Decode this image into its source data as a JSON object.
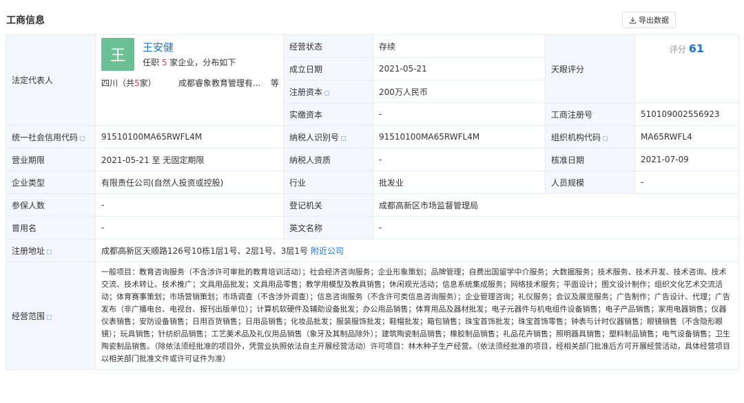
{
  "header": {
    "title": "工商信息",
    "export_label": "导出数据"
  },
  "legal_rep": {
    "label": "法定代表人",
    "avatar_char": "王",
    "name": "王安健",
    "desc_prefix": "任职 ",
    "desc_count": "5",
    "desc_suffix": " 家企业，分布如下",
    "region_prefix": "四川（共",
    "region_count": "5",
    "region_suffix": "家）",
    "company": "成都睿象教育管理有...",
    "more": "等"
  },
  "rows": {
    "status_label": "经营状态",
    "status_value": "存续",
    "founded_label": "成立日期",
    "founded_value": "2021-05-21",
    "reg_capital_label": "注册资本",
    "reg_capital_value": "200万人民币",
    "paid_capital_label": "实缴资本",
    "paid_capital_value": "-",
    "score_label": "天眼评分",
    "score_small_label": "评分",
    "score_value": "61",
    "biz_reg_no_label": "工商注册号",
    "biz_reg_no_value": "510109002556923",
    "credit_code_label": "统一社会信用代码",
    "credit_code_value": "91510100MA65RWFL4M",
    "taxpayer_id_label": "纳税人识别号",
    "taxpayer_id_value": "91510100MA65RWFL4M",
    "org_code_label": "组织机构代码",
    "org_code_value": "MA65RWFL4",
    "term_label": "营业期限",
    "term_value": "2021-05-21 至 无固定期限",
    "taxpayer_qual_label": "纳税人资质",
    "taxpayer_qual_value": "-",
    "approve_date_label": "核准日期",
    "approve_date_value": "2021-07-09",
    "company_type_label": "企业类型",
    "company_type_value": "有限责任公司(自然人投资或控股)",
    "industry_label": "行业",
    "industry_value": "批发业",
    "staff_size_label": "人员规模",
    "staff_size_value": "-",
    "insured_label": "参保人数",
    "insured_value": "-",
    "reg_authority_label": "登记机关",
    "reg_authority_value": "成都高新区市场监督管理局",
    "former_name_label": "曾用名",
    "former_name_value": "-",
    "english_name_label": "英文名称",
    "english_name_value": "-",
    "address_label": "注册地址",
    "address_value": "成都高新区天顺路126号10栋1层1号、2层1号、3层1号",
    "nearby_label": "附近公司",
    "scope_label": "经营范围",
    "scope_value": "一般项目：教育咨询服务（不含涉许可审批的教育培训活动）；社会经济咨询服务；企业形象策划；品牌管理；自费出国留学中介服务；大数据服务；技术服务、技术开发、技术咨询、技术交流、技术转让、技术推广；文具用品批发；文具用品零售；教学用模型及教具销售；休闲观光活动；信息系统集成服务；网络技术服务；平面设计；图文设计制作；组织文化艺术交流活动；体育赛事策划；市场营销策划；市场调查（不含涉外调查）；信息咨询服务（不含许可类信息咨询服务）；企业管理咨询；礼仪服务；会议及展览服务；广告制作；广告设计、代理；广告发布（非广播电台、电视台、报刊出版单位）；计算机软硬件及辅助设备批发；办公用品销售；体育用品及器材批发；电子元器件与机电组件设备销售；电子产品销售；家用电器销售；仪器仪表销售；安防设备销售；日用百货销售；日用品销售；化妆品批发；服装服饰批发；鞋帽批发；箱包销售；珠宝首饰批发；珠宝首饰零售；钟表与计时仪器销售；眼镜销售（不含隐形眼镜）；玩具销售；针纺织品销售；工艺美术品及礼仪用品销售（象牙及其制品除外）；建筑陶瓷制品销售；橡胶制品销售；礼品花卉销售；照明器具销售；塑料制品销售；电气设备销售；卫生陶瓷制品销售。（除依法须经批准的项目外，凭营业执照依法自主开展经营活动）许可项目：林木种子生产经营。（依法须经批准的项目，经相关部门批准后方可开展经营活动，具体经营项目以相关部门批准文件或许可证件为准）"
  },
  "icons": {
    "export": "download-icon",
    "info": "info-icon"
  },
  "colors": {
    "accent": "#1a73d6",
    "label_bg": "#f3f6fb",
    "avatar_bg": "#6cc095",
    "highlight": "#e0414f"
  }
}
